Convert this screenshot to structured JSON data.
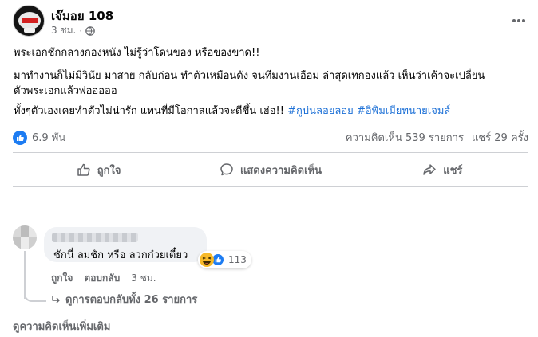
{
  "post": {
    "page_name": "เจ๊มอย 108",
    "time": "3 ชม.",
    "dot": "·",
    "body_lines": [
      "พระเอกชักกลางกองหนัง ไม่รู้ว่าโดนของ หรือของขาด!!",
      "มาทำงานก็ไม่มีวินัย มาสาย กลับก่อน ทำตัวเหมือนดัง จนทีมงานเอือม ล่าสุดเทกองแล้ว เห็นว่าเค้าจะเปลี่ยน",
      "ตัวพระเอกแล้วพ่อออออ",
      "ทั้งๆตัวเองเคยทำตัวไม่น่ารัก แทนที่มีโอกาสแล้วจะดีขึ้น เฮ่อ!!"
    ],
    "hashtags": [
      "#กูบ่นลอยลอย",
      "#อิพิมเมียทนายเจมส์"
    ]
  },
  "stats": {
    "reaction_count": "6.9 พัน",
    "comments": "ความคิดเห็น 539 รายการ",
    "shares": "แชร์ 29 ครั้ง"
  },
  "actions": {
    "like": "ถูกใจ",
    "comment": "แสดงความคิดเห็น",
    "share": "แชร์"
  },
  "comment": {
    "text": "ชักนี่ ลมชัก หรือ ลวกก๋วยเตี๋ยว",
    "reaction_count": "113",
    "like": "ถูกใจ",
    "reply": "ตอบกลับ",
    "time": "3 ชม.",
    "view_replies": "ดูการตอบกลับทั้ง 26 รายการ"
  },
  "more_comments": "ดูความคิดเห็นเพิ่มเติม",
  "colors": {
    "accent": "#1d7cf2",
    "hashtag": "#1b6fd6",
    "muted": "#65676b",
    "bubble": "#f0f2f5"
  },
  "icons": [
    "globe-icon",
    "more-icon",
    "like-icon",
    "comment-icon",
    "share-icon",
    "haha-icon",
    "reply-arrow-icon"
  ]
}
